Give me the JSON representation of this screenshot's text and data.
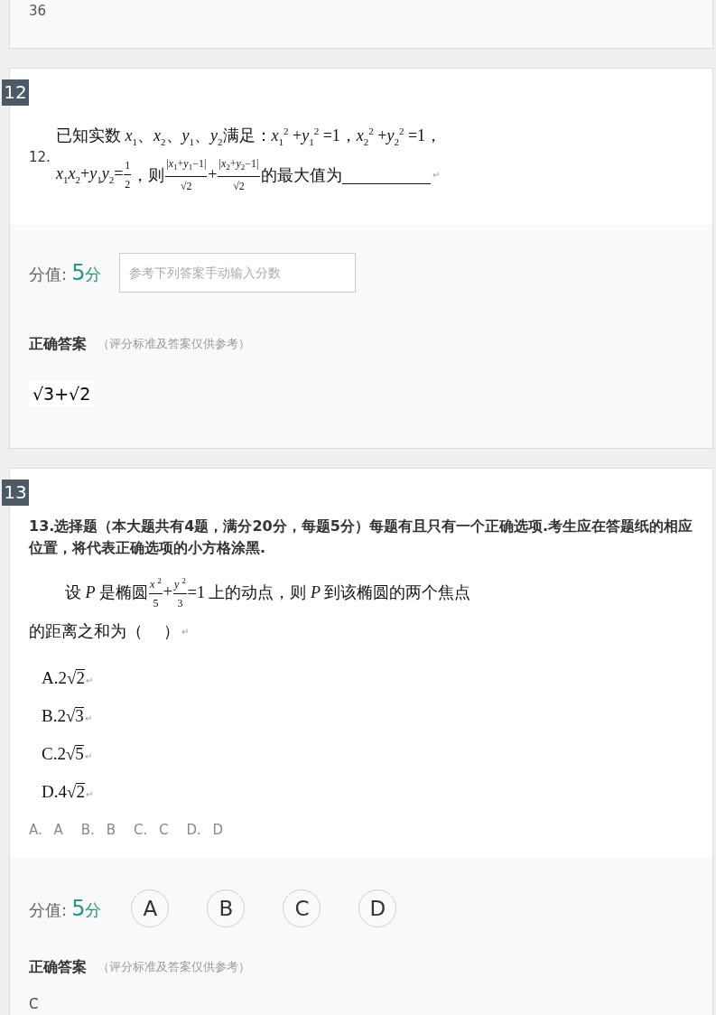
{
  "previous_answer": {
    "text": "36"
  },
  "questions": [
    {
      "kind": "fill",
      "badge": "12",
      "number": "12.",
      "lines": [
        {
          "parts": [
            {
              "kind": "text",
              "text": "已知实数 *x*$_{1}$、*x*$_{2}$、*y*$_{1}$、*y*$_{2}$满足：*x*$_{1}$$^{2}$ +*y*$_{1}$$^{2}$ =1，*x*$_{2}$$^{2}$ +*y*$_{2}$$^{2}$ =1，"
            }
          ]
        },
        {
          "parts": [
            {
              "kind": "text",
              "text": "*x*$_{1}$*x*$_{2}$+*y*$_{1}$*y*$_{2}$="
            },
            {
              "kind": "frac",
              "num": "1",
              "den": "2"
            },
            {
              "kind": "text",
              "text": "，则"
            },
            {
              "kind": "frac",
              "num": "|*x*$_{1}$+*y*$_{1}$−1|",
              "den": "√2"
            },
            {
              "kind": "text",
              "text": "+"
            },
            {
              "kind": "frac",
              "num": "|*x*$_{2}$+*y*$_{2}$−1|",
              "den": "√2"
            },
            {
              "kind": "text",
              "text": "的最大值为"
            }
          ],
          "blank": true,
          "mark": "↵"
        }
      ],
      "score": {
        "label": "分值:",
        "value": "5",
        "unit": "分"
      },
      "score_input": {
        "placeholder": "参考下列答案手动输入分数"
      },
      "answer": {
        "title": "正确答案",
        "note": "（评分标准及答案仅供参考）",
        "kind": "handwritten",
        "value": "√3+√2"
      }
    },
    {
      "kind": "choice",
      "badge": "13",
      "heading": "13.选择题（本大题共有4题，满分20分，每题5分）每题有且只有一个正确选项.考生应在答题纸的相应位置，将代表正确选项的小方格涂黑.",
      "lines": [
        {
          "parts": [
            {
              "kind": "text",
              "text": "设 *P* 是椭圆"
            },
            {
              "kind": "frac",
              "num": "*x* $^{2}$",
              "den": "5"
            },
            {
              "kind": "text",
              "text": "+"
            },
            {
              "kind": "frac",
              "num": "*y* $^{2}$",
              "den": "3"
            },
            {
              "kind": "text",
              "text": "=1 上的动点，则 *P* 到该椭圆的两个焦点"
            }
          ]
        },
        {
          "parts": [
            {
              "kind": "text",
              "text": "的距离之和为（　 ）"
            }
          ],
          "mark": "↵"
        }
      ],
      "options": [
        {
          "prefix": "A.2√",
          "radicand": "2",
          "mark": "↵"
        },
        {
          "prefix": "B.2√",
          "radicand": "3",
          "mark": "↵"
        },
        {
          "prefix": "C.2√",
          "radicand": "5",
          "mark": "↵"
        },
        {
          "prefix": "D.4√",
          "radicand": "2",
          "mark": "↵"
        }
      ],
      "choices": [
        {
          "key": "A.",
          "label": "A"
        },
        {
          "key": "B.",
          "label": "B"
        },
        {
          "key": "C.",
          "label": "C"
        },
        {
          "key": "D.",
          "label": "D"
        }
      ],
      "score": {
        "label": "分值:",
        "value": "5",
        "unit": "分"
      },
      "score_buttons": [
        {
          "label": "A",
          "selected": false
        },
        {
          "label": "B",
          "selected": false
        },
        {
          "label": "C",
          "selected": false
        },
        {
          "label": "D",
          "selected": false
        }
      ],
      "answer": {
        "title": "正确答案",
        "note": "（评分标准及答案仅供参考）",
        "kind": "text",
        "value": "C"
      }
    }
  ]
}
